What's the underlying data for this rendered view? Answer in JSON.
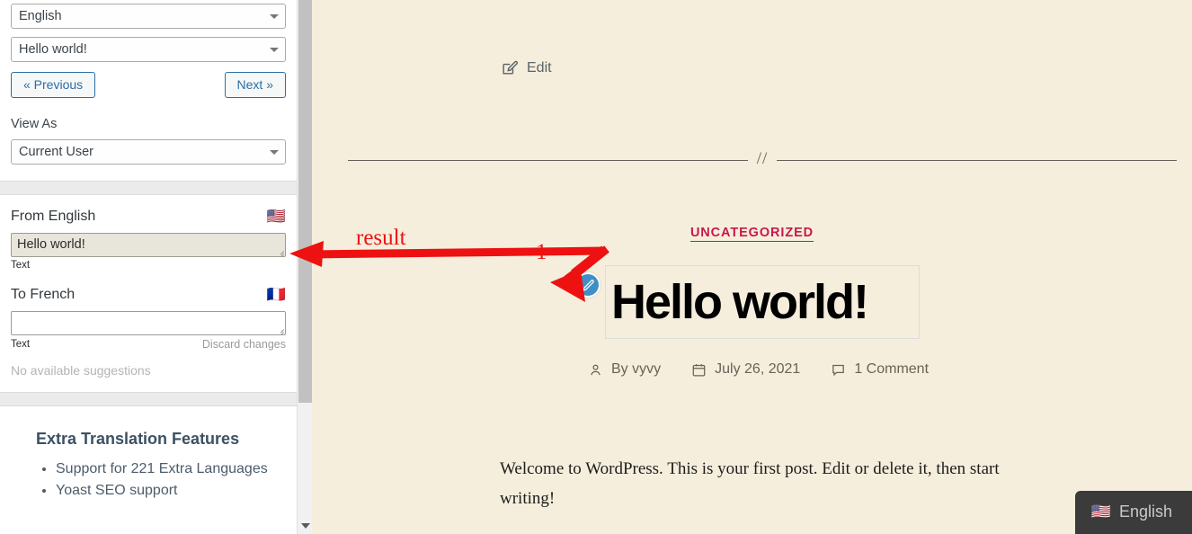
{
  "sidebar": {
    "language_select": {
      "value": "English",
      "caret_icon": "chevron-down-icon"
    },
    "string_select": {
      "value": "Hello world!",
      "caret_icon": "chevron-down-icon"
    },
    "prev_button": "« Previous",
    "next_button": "Next »",
    "view_as_label": "View As",
    "view_as_select": {
      "value": "Current User",
      "caret_icon": "chevron-down-icon"
    },
    "source": {
      "heading": "From English",
      "flag": "🇺🇸",
      "value": "Hello world!",
      "caption": "Text"
    },
    "target": {
      "heading": "To French",
      "flag": "🇫🇷",
      "value": "",
      "placeholder": "",
      "caption": "Text",
      "discard_link": "Discard changes"
    },
    "no_suggestions": "No available suggestions",
    "extra": {
      "heading": "Extra Translation Features",
      "items": [
        "Support for 221 Extra Languages",
        "Yoast SEO support"
      ]
    },
    "scrollbar": {
      "down_arrow_icon": "chevron-down-icon"
    }
  },
  "main": {
    "edit_link": {
      "label": "Edit",
      "icon": "edit-pencil-square-icon"
    },
    "divider_mark": "//",
    "category": "UNCATEGORIZED",
    "pencil_button_icon": "pencil-icon",
    "post_title": "Hello world!",
    "meta": {
      "author": {
        "icon": "person-icon",
        "label": "By vyvy"
      },
      "date": {
        "icon": "calendar-icon",
        "label": "July 26, 2021"
      },
      "comments": {
        "icon": "comment-icon",
        "label": "1 Comment"
      }
    },
    "body": "Welcome to WordPress. This is your first post. Edit or delete it, then start writing!",
    "language_badge": {
      "flag": "🇺🇸",
      "label": "English"
    }
  },
  "annotations": {
    "result_label": "result",
    "step_label": "1",
    "color": "#ee1111"
  },
  "colors": {
    "page_background": "#f5eedd",
    "category_link": "#c9184a",
    "pencil_button": "#3f8ec4",
    "button_border": "#2a6ea6",
    "annotation_red": "#ee1111",
    "badge_background": "#3b3b3b"
  }
}
